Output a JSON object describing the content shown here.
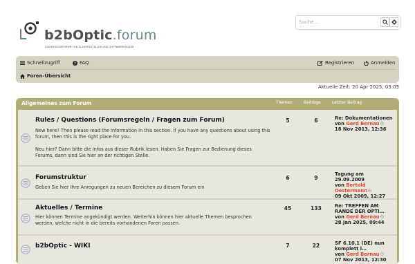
{
  "logo": {
    "brand_b2b": "b2bOptic",
    "brand_forum": ".forum",
    "tagline": "DISKUSSIONSFORUM FÜR GLASHERSTELLER UND SOFTWAREHÄUSER"
  },
  "search": {
    "placeholder": "Suche…"
  },
  "nav": {
    "quicklinks": "Schnellzugriff",
    "faq": "FAQ",
    "register": "Registrieren",
    "login": "Anmelden",
    "breadcrumb": "Foren-Übersicht"
  },
  "current_time": "Aktuelle Zeit: 20 Apr 2025, 03:03",
  "category": {
    "title": "Allgemeines zum Forum",
    "col_topics": "Themen",
    "col_posts": "Beiträge",
    "col_last": "Letzter Beitrag"
  },
  "forums": [
    {
      "title": "Rules / Questions (Forumsregeln / Fragen zum Forum)",
      "desc": "New here? Then please read the information in this section. If you have any questions about using this forum, then this is the right place for you.\n\nNeu hier? Dann bitte die Infos aus dieser Rubrik lesen. Haben Sie Fragen zur Bedienung dieses Forums, dann sind Sie hier an der richtigen Stelle.",
      "topics": "5",
      "posts": "6",
      "last_title": "Re: Dokumentationen",
      "last_by": "von",
      "last_author": "Gerd Bernau",
      "last_date": "18 Nov 2013, 12:36"
    },
    {
      "title": "Forumstruktur",
      "desc": "Geben Sie hier Ihre Anregungen zu neuen Bereichen zu diesem Forum ein",
      "topics": "6",
      "posts": "9",
      "last_title": "Tagung am 29.09.2009",
      "last_by": "von",
      "last_author_1": "Bertold",
      "last_author_2": "Oestermann",
      "last_date": "09 Okt 2009, 12:27"
    },
    {
      "title": "Aktuelles / Termine",
      "desc": "Hier können Termine angekündigt werden. Weiterhin können hier aktuelle Themen besprochen werden, welche nicht in die bereits vorhandenen Foren passen.",
      "topics": "45",
      "posts": "133",
      "last_title_1": "Re: TREFFEN AM",
      "last_title_2": "RANDE DER OPTI…",
      "last_by": "von",
      "last_author": "Gerd Bernau",
      "last_date": "28 Jan 2025, 09:44"
    },
    {
      "title": "b2bOptic - WIKI",
      "desc": "",
      "topics": "7",
      "posts": "22",
      "last_title_1": "SF 6.10.1 (DE) nun",
      "last_title_2": "komplett l…",
      "last_by": "von",
      "last_author": "Gerd Bernau",
      "last_date": "07 Nov 2013, 12:30"
    }
  ],
  "colors": {
    "header": "#b2ad77",
    "navbar": "#d5d3c1",
    "row": "#e8e7de",
    "author": "#e0462f",
    "brand_teal": "#5f8a88"
  },
  "icons": {
    "logo_mark": "camera-lens-icon",
    "search": "search-icon",
    "advanced_search": "gear-icon",
    "quicklinks": "menu-icon",
    "faq": "question-icon",
    "register": "edit-icon",
    "login": "power-icon",
    "home": "home-icon",
    "forum_status": "forum-read-icon",
    "view_post": "external-link-icon"
  }
}
